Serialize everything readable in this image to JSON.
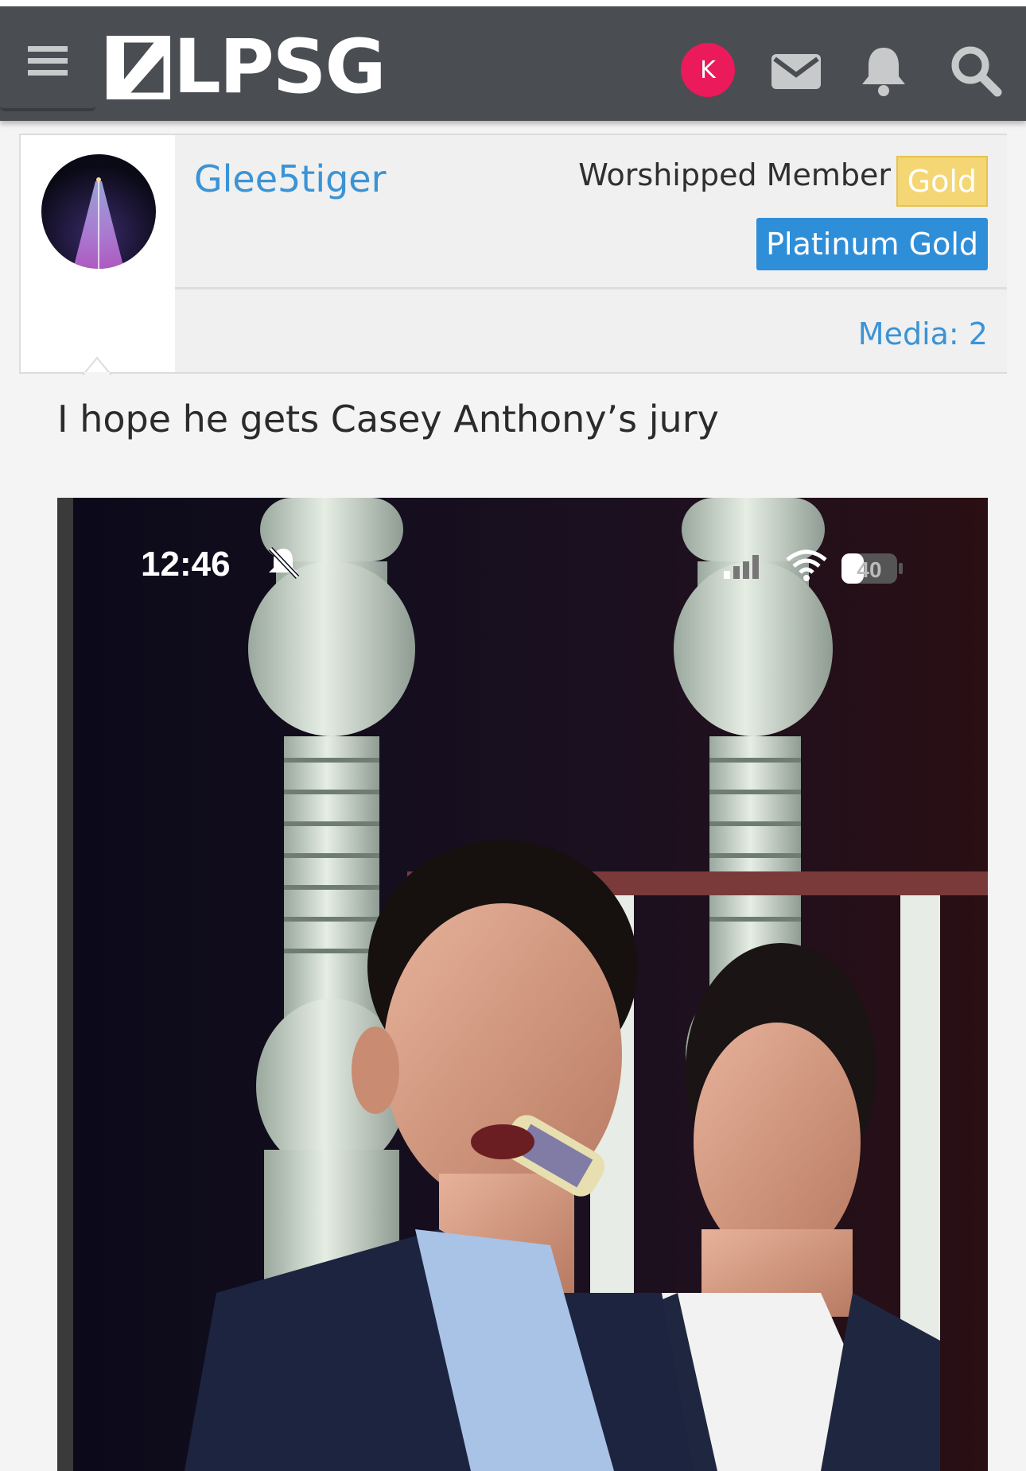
{
  "header": {
    "logo_text": "LPSG",
    "account_initial": "K",
    "icons": [
      "menu-icon",
      "logo-icon",
      "envelope-icon",
      "bell-icon",
      "search-icon"
    ],
    "colors": {
      "bar": "#4a4d52",
      "account": "#ea1a5b"
    }
  },
  "post": {
    "username": "Glee5tiger",
    "user_title": "Worshipped Member",
    "badge_gold": "Gold",
    "badge_platinum": "Platinum Gold",
    "media_label": "Media: 2",
    "message": "I hope he gets Casey Anthony’s jury",
    "colors": {
      "link": "#3b93d6",
      "gold": "#f4d774",
      "platinum": "#2f8ed8"
    }
  },
  "attachment": {
    "status_time": "12:46",
    "battery": "40",
    "status_icons": [
      "bell-slash-icon",
      "signal-icon",
      "wifi-icon",
      "battery-icon"
    ]
  }
}
